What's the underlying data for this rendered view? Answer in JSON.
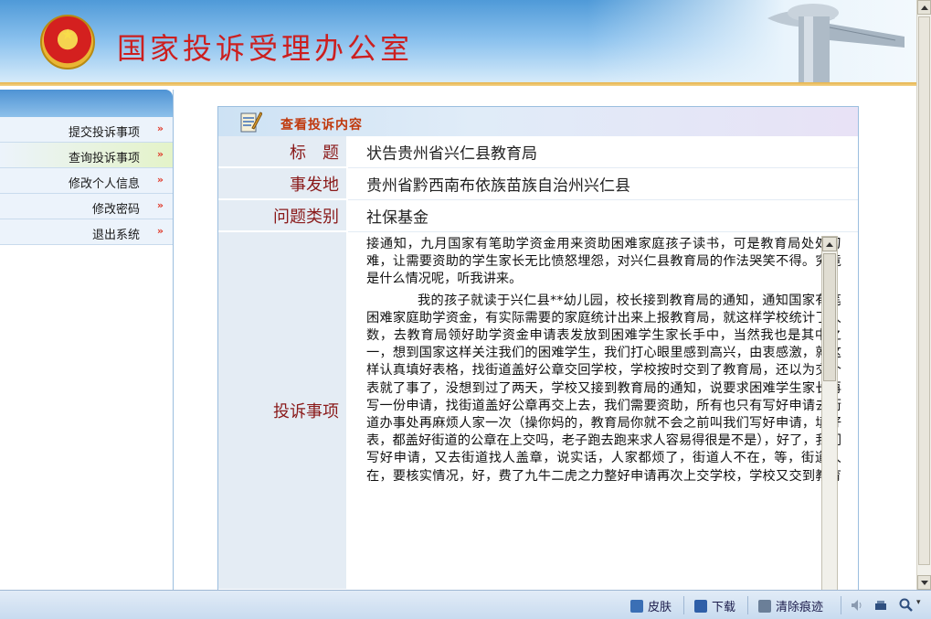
{
  "header": {
    "site_title": "国家投诉受理办公室"
  },
  "nav": {
    "items": [
      {
        "label": "提交投诉事项",
        "arrow": "»"
      },
      {
        "label": "查询投诉事项",
        "arrow": "»"
      },
      {
        "label": "修改个人信息",
        "arrow": "»"
      },
      {
        "label": "修改密码",
        "arrow": "»"
      },
      {
        "label": "退出系统",
        "arrow": "»"
      }
    ],
    "active_index": 1
  },
  "panel": {
    "title": "查看投诉内容",
    "fields": [
      {
        "label": "标　题",
        "value": "状告贵州省兴仁县教育局"
      },
      {
        "label": "事发地",
        "value": "贵州省黔西南布依族苗族自治州兴仁县"
      },
      {
        "label": "问题类别",
        "value": "社保基金"
      }
    ],
    "complaint_label": "投诉事项",
    "complaint_paragraphs": [
      "接通知，九月国家有笔助学资金用来资助困难家庭孩子读书，可是教育局处处刁难，让需要资助的学生家长无比愤怒埋怨，对兴仁县教育局的作法哭笑不得。究竟是什么情况呢，听我讲来。",
      "我的孩子就读于兴仁县**幼儿园，校长接到教育局的通知，通知国家有笔困难家庭助学资金，有实际需要的家庭统计出来上报教育局，就这样学校统计了人数，去教育局领好助学资金申请表发放到困难学生家长手中，当然我也是其中之一，想到国家这样关注我们的困难学生，我们打心眼里感到高兴，由衷感激，就这样认真填好表格，找街道盖好公章交回学校，学校按时交到了教育局，还以为交个表就了事了，没想到过了两天，学校又接到教育局的通知，说要求困难学生家长再写一份申请，找街道盖好公章再交上去，我们需要资助，所有也只有写好申请去街道办事处再麻烦人家一次（操你妈的，教育局你就不会之前叫我们写好申请，填好表，都盖好街道的公章在上交吗，老子跑去跑来求人容易得很是不是），好了，我们写好申请，又去街道找人盖章，说实话，人家都烦了，街道人不在，等，街道人在，要核实情况，好，费了九牛二虎之力整好申请再次上交学校，学校又交到教育局，就这样，还以为已经完事，没过两天他妈的教育局将申请全部退回，说都写得不正式，他妈了个逼，就是拿我们这些困难家庭开刷，找借口不发资金"
    ]
  },
  "statusbar": {
    "skin": "皮肤",
    "download": "下载",
    "clear_trace": "清除痕迹"
  },
  "colors": {
    "title_red": "#cc1f1f",
    "label_text": "#8a1a1a",
    "panel_title": "#c0390d",
    "nav_arrow": "#e03a2a"
  }
}
